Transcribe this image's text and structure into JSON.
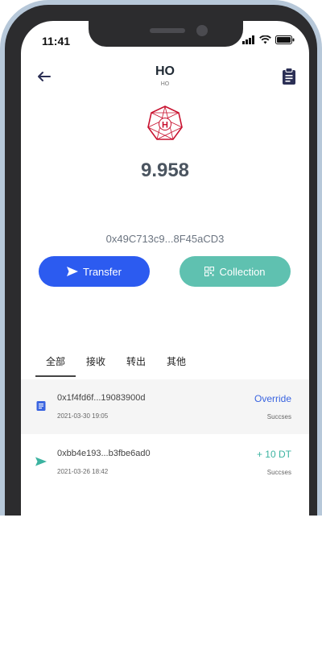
{
  "status_bar": {
    "time": "11:41",
    "icons": [
      "signal-icon",
      "wifi-icon",
      "battery-icon"
    ]
  },
  "header": {
    "title": "HO",
    "subtitle": "HO",
    "back_icon": "arrow-left-icon",
    "action_icon": "clipboard-icon"
  },
  "token": {
    "logo_letter": "H",
    "balance": "9.958",
    "address": "0x49C713c9...8F45aCD3"
  },
  "actions": {
    "transfer_label": "Transfer",
    "collection_label": "Collection"
  },
  "tabs": [
    {
      "label": "全部"
    },
    {
      "label": "接收"
    },
    {
      "label": "转出"
    },
    {
      "label": "其他"
    }
  ],
  "transactions": [
    {
      "hash": "0x1f4fd6f...19083900d",
      "date": "2021-03-30 19:05",
      "amount": "Override",
      "status": "Succses",
      "icon": "document-icon"
    },
    {
      "hash": "0xbb4e193...b3fbe6ad0",
      "date": "2021-03-26 18:42",
      "amount": "+ 10 DT",
      "status": "Succses",
      "icon": "send-icon"
    }
  ],
  "colors": {
    "primary": "#2c5bf0",
    "teal": "#5fc1b0",
    "logo_red": "#c8102e",
    "override_blue": "#3a64e0",
    "income_green": "#3bb3a0"
  }
}
